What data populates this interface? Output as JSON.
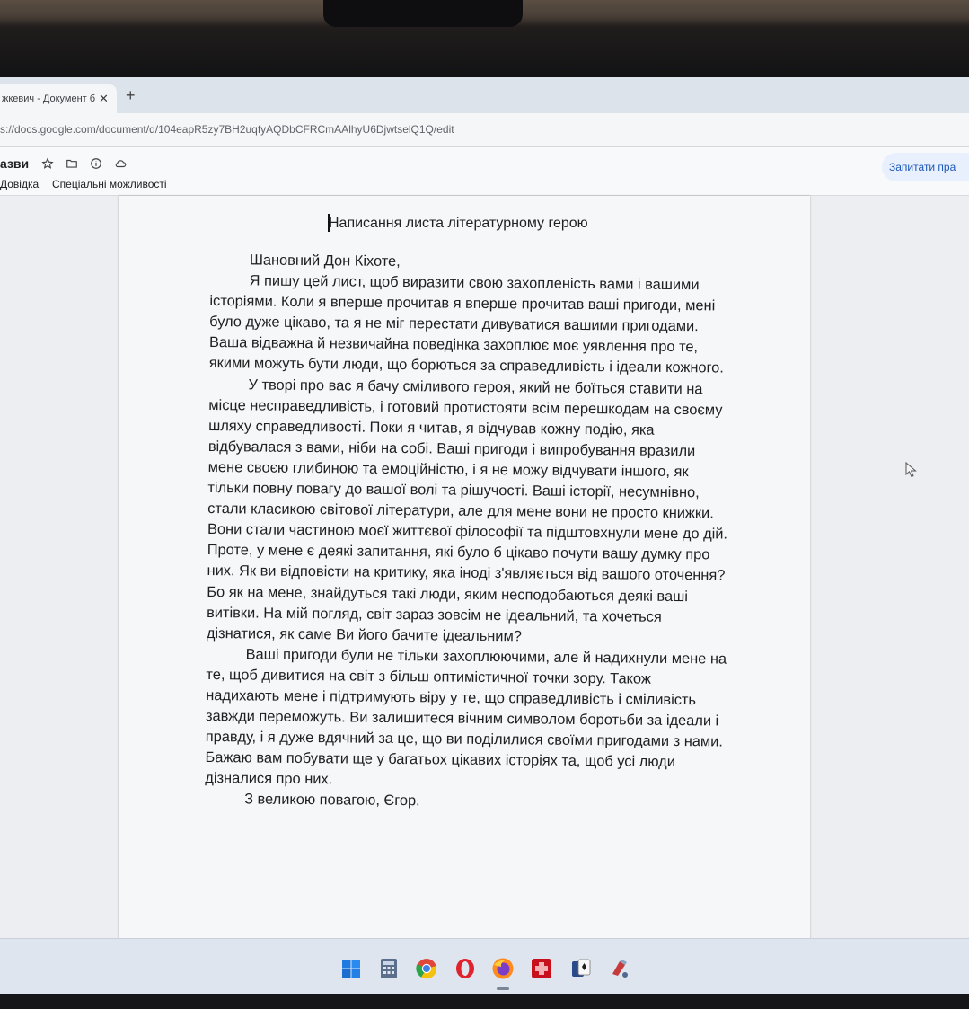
{
  "browser": {
    "tab_title": "жкевич - Документ бе",
    "tab_close": "✕",
    "new_tab": "+",
    "url": "s://docs.google.com/document/d/104eapR5zy7BH2uqfyAQDbCFRCmAAlhyU6DjwtselQ1Q/edit"
  },
  "docs": {
    "title": "азви",
    "menu": [
      "Довідка",
      "Спеціальні можливості"
    ],
    "share_label": "Запитати пра"
  },
  "document": {
    "heading": "Написання листа літературному герою",
    "paragraphs": [
      "Шановний Дон Кіхоте,",
      "Я пишу цей лист, щоб виразити свою захопленість вами і вашими історіями. Коли я вперше прочитав я вперше прочитав ваші пригоди, мені було дуже цікаво, та я не міг перестати дивуватися вашими пригодами. Ваша відважна й незвичайна поведінка захоплює моє уявлення про те, якими можуть бути люди, що борються за справедливість і ідеали кожного.",
      "У творі про вас я бачу сміливого героя, який не боїться ставити на місце несправедливість, і готовий протистояти всім перешкодам на своєму шляху справедливості. Поки я читав, я відчував кожну подію, яка відбувалася з вами, ніби на собі. Ваші пригоди і випробування вразили мене своєю глибиною та емоційністю, і я не можу відчувати іншого, як тільки повну повагу до вашої волі та рішучості. Ваші історії, несумнівно, стали класикою світової літератури, але для мене вони не просто книжки. Вони стали частиною моєї життєвої філософії та підштовхнули мене до дій. Проте, у мене є деякі запитання, які було б цікаво почути вашу думку про них. Як ви відповісти на критику, яка іноді з'являється від вашого оточення? Бо як на мене, знайдуться такі люди, яким несподобаються деякі ваші витівки. На мій погляд, світ зараз зовсім не ідеальний, та хочеться дізнатися, як саме Ви його бачите ідеальним?",
      "Ваші пригоди були не тільки захоплюючими, але й надихнули мене на те, щоб дивитися на світ з більш оптимістичної точки зору. Також надихають мене і підтримують віру у те, що справедливість і сміливість завжди переможуть. Ви залишитеся вічним символом боротьби за ідеали і правду, і я дуже вдячний за це, що ви поділилися своїми пригодами з нами. Бажаю вам побувати ще у багатьох цікавих історіях та, щоб усі люди дізналися про них.",
      "З великою повагою, Єгор."
    ]
  },
  "taskbar": {
    "icons": [
      "windows-start-icon",
      "calculator-icon",
      "chrome-icon",
      "opera-icon",
      "firefox-icon",
      "red-app-icon",
      "solitaire-icon",
      "paint-icon"
    ]
  }
}
